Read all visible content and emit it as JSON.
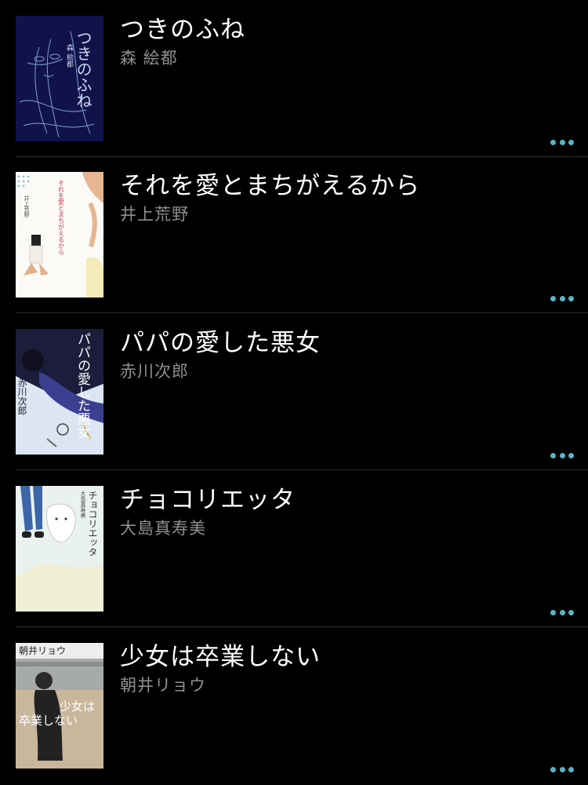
{
  "accent_color": "#5ab4c4",
  "books": [
    {
      "title": "つきのふね",
      "author": "森 絵都",
      "cover_text": [
        "つきのふね",
        "森 絵都"
      ],
      "cover_colors": {
        "bg": "#10134a",
        "line": "#7f9dd8"
      },
      "more_icon": "ellipsis-icon"
    },
    {
      "title": "それを愛とまちがえるから",
      "author": "井上荒野",
      "cover_text": [
        "それを愛とまちがえるから",
        "井上荒野"
      ],
      "cover_colors": {
        "bg": "#fbfaf6",
        "accent": "#e7b58f"
      },
      "more_icon": "ellipsis-icon"
    },
    {
      "title": "パパの愛した悪女",
      "author": "赤川次郎",
      "cover_text": [
        "パパの愛した悪女",
        "赤川次郎"
      ],
      "cover_colors": {
        "bg": "#dce6f2",
        "dark": "#1b1d3a"
      },
      "more_icon": "ellipsis-icon"
    },
    {
      "title": "チョコリエッタ",
      "author": "大島真寿美",
      "cover_text": [
        "チョコリエッタ",
        "大島真寿美"
      ],
      "cover_colors": {
        "bg": "#e9f2ef",
        "legs": "#3c66a8"
      },
      "more_icon": "ellipsis-icon"
    },
    {
      "title": "少女は卒業しない",
      "author": "朝井リョウ",
      "cover_text": [
        "朝井リョウ",
        "少女は",
        "卒業しない"
      ],
      "cover_colors": {
        "bg": "#d8d2c4",
        "sky": "#eeeeec"
      },
      "more_icon": "ellipsis-icon"
    }
  ]
}
